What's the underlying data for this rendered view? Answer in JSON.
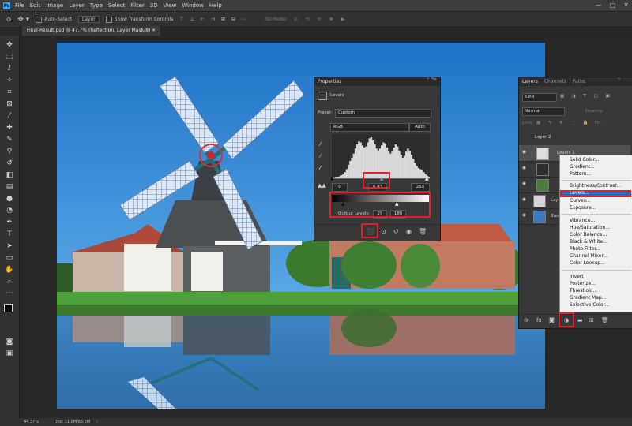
{
  "app": {
    "logo": "Ps"
  },
  "menubar": {
    "items": [
      "File",
      "Edit",
      "Image",
      "Layer",
      "Type",
      "Select",
      "Filter",
      "3D",
      "View",
      "Window",
      "Help"
    ]
  },
  "optionsbar": {
    "auto_select": "Auto-Select",
    "auto_select_target": "Layer",
    "show_transform": "Show Transform Controls",
    "mode_3d": "3D Mode:"
  },
  "document": {
    "tab_title": "Final-Result.psd @ 47.7% (Reflection, Layer Mask/8)"
  },
  "status": {
    "zoom": "44.37%",
    "doc": "Doc: 11.0M/65.5M"
  },
  "properties": {
    "tab": "Properties",
    "panel_title": "Levels",
    "preset_label": "Preset:",
    "preset_value": "Custom",
    "channel": "RGB",
    "auto_label": "Auto",
    "input_black": "0",
    "input_gamma": "0.93",
    "input_white": "255",
    "output_label": "Output Levels:",
    "output_black": "29",
    "output_white": "186",
    "histogram": [
      2,
      2,
      3,
      3,
      4,
      6,
      8,
      12,
      18,
      26,
      34,
      40,
      48,
      58,
      66,
      72,
      70,
      64,
      60,
      62,
      70,
      78,
      80,
      74,
      66,
      58,
      54,
      58,
      64,
      70,
      68,
      60,
      52,
      48,
      52,
      60,
      66,
      62,
      54,
      46,
      40,
      44,
      52,
      58,
      54,
      46,
      38,
      30,
      24,
      20,
      18,
      16,
      12,
      8,
      5,
      3
    ]
  },
  "layers": {
    "tabs": [
      "Layers",
      "Channels",
      "Paths"
    ],
    "search": "Kind",
    "blend_mode": "Normal",
    "opacity_label": "Opacity:",
    "lock_label": "Lock:",
    "fill_label": "Fill:",
    "rows": [
      "Layer 2",
      "Levels 1",
      "",
      "",
      "Layer",
      "Background"
    ]
  },
  "adjust_menu": {
    "groups": [
      [
        "Solid Color...",
        "Gradient...",
        "Pattern..."
      ],
      [
        "Brightness/Contrast...",
        "Levels...",
        "Curves...",
        "Exposure..."
      ],
      [
        "Vibrance...",
        "Hue/Saturation...",
        "Color Balance...",
        "Black & White...",
        "Photo Filter...",
        "Channel Mixer...",
        "Color Lookup..."
      ],
      [
        "Invert",
        "Posterize...",
        "Threshold...",
        "Gradient Map...",
        "Selective Color..."
      ]
    ],
    "highlighted": "Levels...",
    "highlight_color": "#1a6fd6"
  },
  "colors": {
    "accent": "#31a8ff",
    "callout": "#e0202a"
  }
}
